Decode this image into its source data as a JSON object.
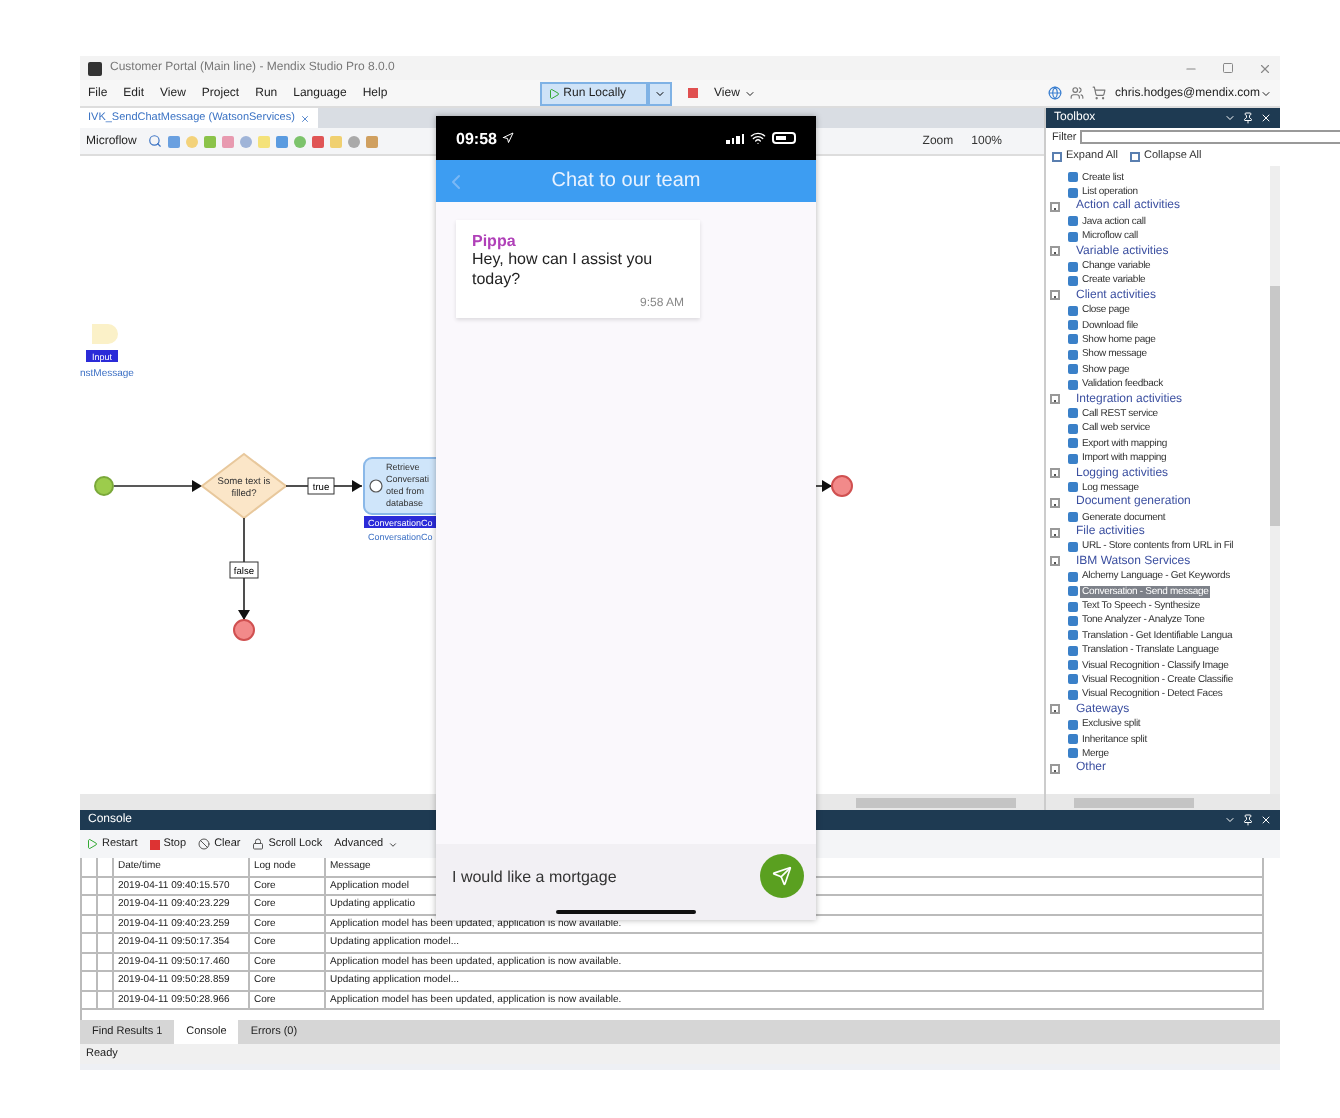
{
  "window": {
    "title": "Customer Portal (Main line) - Mendix Studio Pro 8.0.0"
  },
  "menu": [
    "File",
    "Edit",
    "View",
    "Project",
    "Run",
    "Language",
    "Help"
  ],
  "run_toolbar": {
    "run_label": "Run Locally",
    "view_label": "View"
  },
  "account": "chris.hodges@mendix.com",
  "document_tabs": [
    {
      "label": "IVK_SendChatMessage (WatsonServices)",
      "selected": true
    }
  ],
  "microflow_toolbar": {
    "label": "Microflow",
    "zoom_label": "Zoom",
    "zoom_value": "100%"
  },
  "canvas": {
    "parameter": {
      "badge": "Input",
      "name": "nstMessage"
    },
    "decision": {
      "lines": [
        "Some text is",
        "filled?"
      ]
    },
    "true_label": "true",
    "false_label": "false",
    "activity": {
      "lines": [
        "Retrieve",
        "Conversati",
        "oted from",
        "database"
      ],
      "badge": "ConversationCo",
      "caption": "ConversationCo"
    }
  },
  "toolbox": {
    "title": "Toolbox",
    "filter_label": "Filter",
    "expand_all": "Expand All",
    "collapse_all": "Collapse All",
    "groups": [
      {
        "items": [
          {
            "label": "Create list",
            "selected": false
          },
          {
            "label": "List operation",
            "selected": false
          }
        ]
      },
      {
        "title": "Action call activities",
        "expanded": true,
        "items": [
          {
            "label": "Java action call",
            "selected": false
          },
          {
            "label": "Microflow call",
            "selected": false
          }
        ]
      },
      {
        "title": "Variable activities",
        "expanded": true,
        "items": [
          {
            "label": "Change variable",
            "selected": false
          },
          {
            "label": "Create variable",
            "selected": false
          }
        ]
      },
      {
        "title": "Client activities",
        "expanded": true,
        "items": [
          {
            "label": "Close page",
            "selected": false
          },
          {
            "label": "Download file",
            "selected": false
          },
          {
            "label": "Show home page",
            "selected": false
          },
          {
            "label": "Show message",
            "selected": false
          },
          {
            "label": "Show page",
            "selected": false
          },
          {
            "label": "Validation feedback",
            "selected": false
          }
        ]
      },
      {
        "title": "Integration activities",
        "expanded": true,
        "items": [
          {
            "label": "Call REST service",
            "selected": false
          },
          {
            "label": "Call web service",
            "selected": false
          },
          {
            "label": "Export with mapping",
            "selected": false
          },
          {
            "label": "Import with mapping",
            "selected": false
          }
        ]
      },
      {
        "title": "Logging activities",
        "expanded": true,
        "items": [
          {
            "label": "Log message",
            "selected": false
          }
        ]
      },
      {
        "title": "Document generation",
        "expanded": true,
        "items": [
          {
            "label": "Generate document",
            "selected": false
          }
        ]
      },
      {
        "title": "File activities",
        "expanded": true,
        "items": [
          {
            "label": "URL - Store contents from URL in Fil",
            "selected": false
          }
        ]
      },
      {
        "title": "IBM Watson Services",
        "expanded": true,
        "items": [
          {
            "label": "Alchemy Language - Get Keywords",
            "selected": false
          },
          {
            "label": "Conversation - Send message",
            "selected": true
          },
          {
            "label": "Text To Speech - Synthesize",
            "selected": false
          },
          {
            "label": "Tone Analyzer - Analyze Tone",
            "selected": false
          },
          {
            "label": "Translation - Get Identifiable Langua",
            "selected": false
          },
          {
            "label": "Translation - Translate Language",
            "selected": false
          },
          {
            "label": "Visual Recognition - Classify Image",
            "selected": false
          },
          {
            "label": "Visual Recognition - Create Classifie",
            "selected": false
          },
          {
            "label": "Visual Recognition - Detect Faces",
            "selected": false
          }
        ]
      },
      {
        "title": "Gateways",
        "expanded": true,
        "items": [
          {
            "label": "Exclusive split",
            "selected": false
          },
          {
            "label": "Inheritance split",
            "selected": false
          },
          {
            "label": "Merge",
            "selected": false
          }
        ]
      },
      {
        "title": "Other",
        "expanded": true
      }
    ]
  },
  "console": {
    "title": "Console",
    "actions": [
      {
        "kind": "restart",
        "label": "Restart"
      },
      {
        "kind": "stop",
        "label": "Stop"
      },
      {
        "kind": "clear",
        "label": "Clear"
      },
      {
        "kind": "lock",
        "label": "Scroll Lock"
      }
    ],
    "advanced": "Advanced",
    "columns": [
      "Date/time",
      "Log node",
      "Message"
    ],
    "rows": [
      {
        "time": "2019-04-11 09:40:15.570",
        "node": "Core",
        "message": "Application model"
      },
      {
        "time": "2019-04-11 09:40:23.229",
        "node": "Core",
        "message": "Updating applicatio"
      },
      {
        "time": "2019-04-11 09:40:23.259",
        "node": "Core",
        "message": "Application model has been updated, application is now available."
      },
      {
        "time": "2019-04-11 09:50:17.354",
        "node": "Core",
        "message": "Updating application model..."
      },
      {
        "time": "2019-04-11 09:50:17.460",
        "node": "Core",
        "message": "Application model has been updated, application is now available."
      },
      {
        "time": "2019-04-11 09:50:28.859",
        "node": "Core",
        "message": "Updating application model..."
      },
      {
        "time": "2019-04-11 09:50:28.966",
        "node": "Core",
        "message": "Application model has been updated, application is now available."
      }
    ]
  },
  "bottom_tabs": [
    {
      "label": "Find Results 1",
      "selected": false
    },
    {
      "label": "Console",
      "selected": true
    },
    {
      "label": "Errors (0)",
      "selected": false
    }
  ],
  "status_bar": "Ready",
  "phone": {
    "time": "09:58",
    "header": "Chat to our team",
    "messages": [
      {
        "sender": "Pippa",
        "text": "Hey, how can I assist you today?",
        "time": "9:58 AM"
      }
    ],
    "input_value": "I would like a mortgage"
  }
}
